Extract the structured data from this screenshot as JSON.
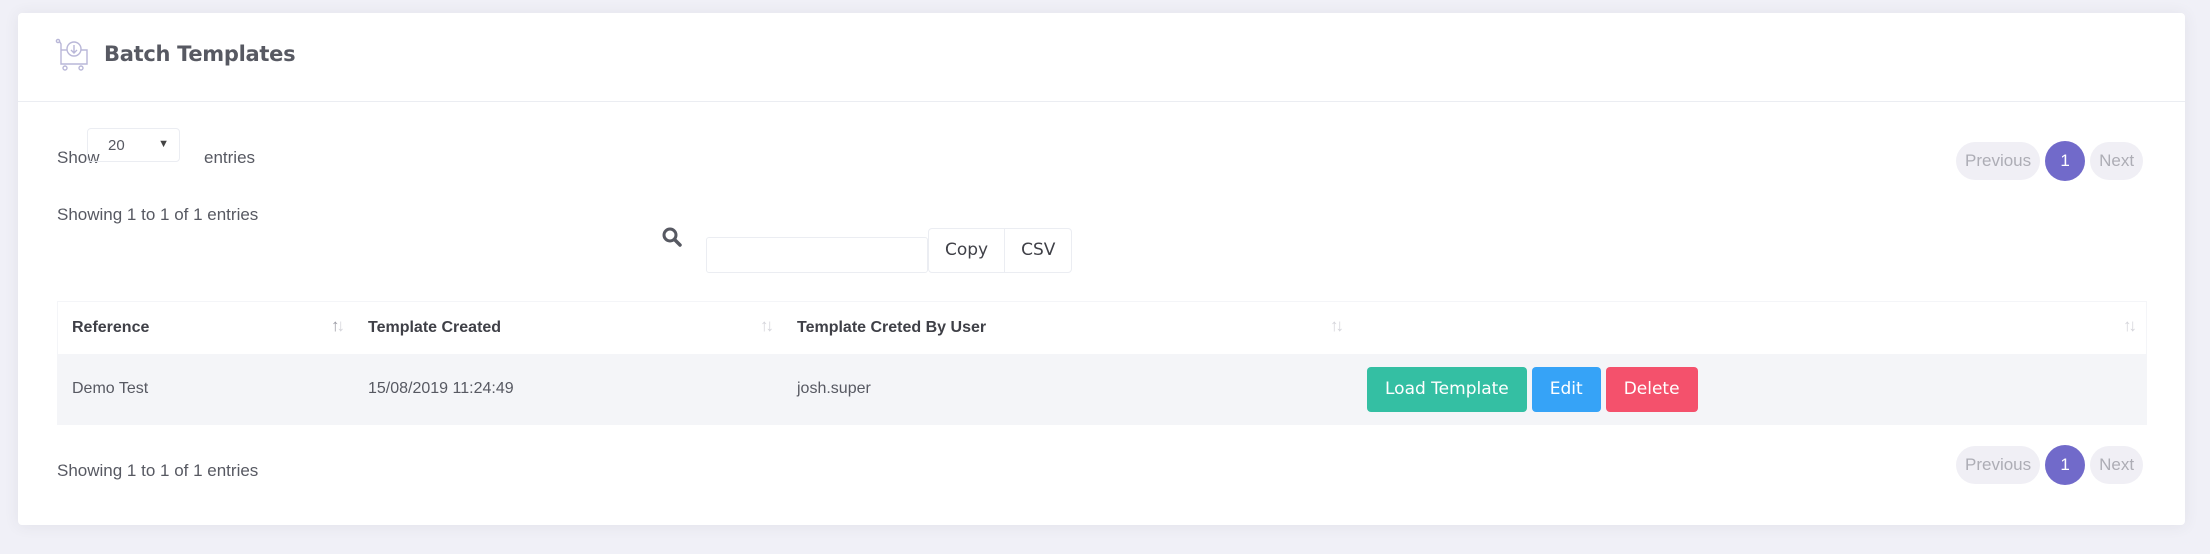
{
  "header": {
    "title": "Batch Templates",
    "icon": "cart-download-icon"
  },
  "length_menu": {
    "label_before": "Show",
    "selected": "20",
    "label_after": "entries"
  },
  "info_top": "Showing 1 to 1 of 1 entries",
  "info_bottom": "Showing 1 to 1 of 1 entries",
  "search": {
    "value": "",
    "placeholder": ""
  },
  "export_buttons": {
    "copy": "Copy",
    "csv": "CSV"
  },
  "pagination": {
    "previous": "Previous",
    "current": "1",
    "next": "Next"
  },
  "table": {
    "columns": [
      "Reference",
      "Template Created",
      "Template Creted By User",
      ""
    ],
    "rows": [
      {
        "reference": "Demo Test",
        "created": "15/08/2019 11:24:49",
        "user": "josh.super",
        "actions": {
          "load": "Load Template",
          "edit": "Edit",
          "delete": "Delete"
        }
      }
    ]
  },
  "colors": {
    "accent": "#716aca",
    "load": "#34bfa3",
    "edit": "#36a3f7",
    "delete": "#f4516c"
  }
}
